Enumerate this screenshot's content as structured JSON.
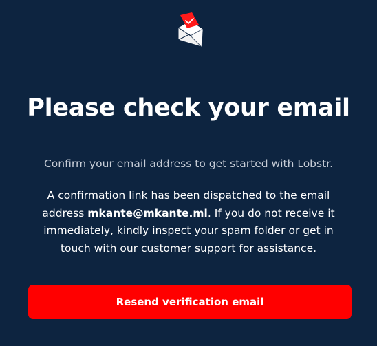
{
  "app": {
    "logo_icon": "envelope-check-icon"
  },
  "main": {
    "title": "Please check your email",
    "subtitle": "Confirm your email address to get started with Lobstr.",
    "body": {
      "before_email": "A confirmation link has been dispatched to the email address ",
      "email": "mkante@mkante.ml",
      "after_email": ". If you do not receive it immediately, kindly inspect your spam folder or get in touch with our customer support for assistance."
    },
    "resend_label": "Resend verification email"
  },
  "colors": {
    "background": "#0d2440",
    "accent": "#ff0000",
    "text": "#ffffff",
    "muted_text": "#c6ccd6"
  }
}
